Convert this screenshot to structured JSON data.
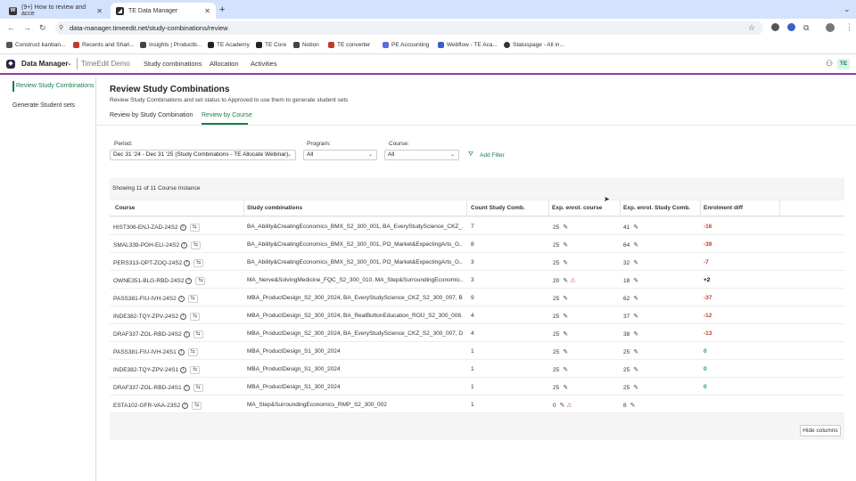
{
  "browser": {
    "tabs": [
      {
        "title": "(9+) How to review and acce",
        "favicon_color": "#333333"
      },
      {
        "title": "TE Data Manager",
        "favicon_color": "#2b2b2b"
      }
    ],
    "url": "data-manager.timeedit.net/study-combinations/review",
    "bookmarks": [
      "Construct kanban...",
      "Recents and Shari...",
      "Insights | Productb...",
      "TE Academy",
      "TE Core",
      "Notion",
      "TE converter",
      "PE Accounting",
      "Webflow - TE Aca...",
      "Statuspage - All in..."
    ]
  },
  "app": {
    "product": "Data Manager",
    "org": "TimeEdit Demo",
    "nav": [
      "Study combinations",
      "Allocation",
      "Activities"
    ],
    "badge": "TE"
  },
  "sidebar": {
    "items": [
      "Review Study Combinations",
      "Generate Student sets"
    ]
  },
  "page": {
    "title": "Review Study Combinations",
    "subtitle": "Review Study Combinations and set status to Approved to use them to generate student sets",
    "tabs": [
      "Review by Study Combination",
      "Review by Course"
    ],
    "filters": {
      "period_label": "Period:",
      "period_value": "Dec 31 '24 - Dec 31 '25 (Study Combinations - TE Allocate Webinar)",
      "program_label": "Program:",
      "program_value": "All",
      "course_label": "Course:",
      "course_value": "All",
      "add_filter": "Add Filter"
    },
    "showing": "Showing 11 of 11 Course Instance",
    "hide_columns": "Hide columns"
  },
  "table": {
    "headers": [
      "Course",
      "Study combinations",
      "Count Study Comb.",
      "Exp. enrol. course",
      "Exp. enrol. Study Comb.",
      "Enrolment diff"
    ],
    "rows": [
      {
        "course": "HIST306-ENJ-ZAD-24S2",
        "combos": "BA_Ability&CreatingEconomics_BMX_S2_300_001, BA_EveryStudyScience_CKZ_...",
        "count": "7",
        "exp_course": "25",
        "warn": false,
        "exp_comb": "41",
        "diff": "-16",
        "diff_kind": "neg"
      },
      {
        "course": "SMAL339-POH-ELI-24S2",
        "combos": "BA_Ability&CreatingEconomics_BMX_S2_300_001, PO_Market&ExpectingArts_G...",
        "count": "8",
        "exp_course": "25",
        "warn": false,
        "exp_comb": "64",
        "diff": "-39",
        "diff_kind": "neg"
      },
      {
        "course": "PERS313-OPT-ZOQ-24S2",
        "combos": "BA_Ability&CreatingEconomics_BMX_S2_300_001, PO_Market&ExpectingArts_G...",
        "count": "3",
        "exp_course": "25",
        "warn": false,
        "exp_comb": "32",
        "diff": "-7",
        "diff_kind": "neg"
      },
      {
        "course": "OWNE351-BLG-RBD-24S2",
        "combos": "MA_Nerve&SolvingMedicine_FQC_S2_300_010, MA_Step&SurroundingEconomic...",
        "count": "3",
        "exp_course": "20",
        "warn": true,
        "exp_comb": "18",
        "diff": "+2",
        "diff_kind": "pos"
      },
      {
        "course": "PASS381-FIU-IVH-24S2",
        "combos": "MBA_ProductDesign_S2_300_2024, BA_EveryStudyScience_CKZ_S2_300_007, B...",
        "count": "9",
        "exp_course": "25",
        "warn": false,
        "exp_comb": "62",
        "diff": "-37",
        "diff_kind": "neg"
      },
      {
        "course": "INDE382-TQY-ZPV-24S2",
        "combos": "MBA_ProductDesign_S2_300_2024, BA_RealButtonEducation_ROU_S2_300_008...",
        "count": "4",
        "exp_course": "25",
        "warn": false,
        "exp_comb": "37",
        "diff": "-12",
        "diff_kind": "neg"
      },
      {
        "course": "DRAF337-ZOL-RBD-24S2",
        "combos": "MBA_ProductDesign_S2_300_2024, BA_EveryStudyScience_CKZ_S2_300_007, D...",
        "count": "4",
        "exp_course": "25",
        "warn": false,
        "exp_comb": "38",
        "diff": "-13",
        "diff_kind": "neg"
      },
      {
        "course": "PASS381-FIU-IVH-24S1",
        "combos": "MBA_ProductDesign_S1_300_2024",
        "count": "1",
        "exp_course": "25",
        "warn": false,
        "exp_comb": "25",
        "diff": "0",
        "diff_kind": "zero"
      },
      {
        "course": "INDE382-TQY-ZPV-24S1",
        "combos": "MBA_ProductDesign_S1_300_2024",
        "count": "1",
        "exp_course": "25",
        "warn": false,
        "exp_comb": "25",
        "diff": "0",
        "diff_kind": "zero"
      },
      {
        "course": "DRAF337-ZOL-RBD-24S1",
        "combos": "MBA_ProductDesign_S1_300_2024",
        "count": "1",
        "exp_course": "25",
        "warn": false,
        "exp_comb": "25",
        "diff": "0",
        "diff_kind": "zero"
      },
      {
        "course": "ESTA102-GFR-VAA-23S2",
        "combos": "MA_Step&SurroundingEconomics_RMP_S2_300_002",
        "count": "1",
        "exp_course": "0",
        "warn": true,
        "exp_comb": "8",
        "diff": "",
        "diff_kind": "none"
      }
    ]
  }
}
